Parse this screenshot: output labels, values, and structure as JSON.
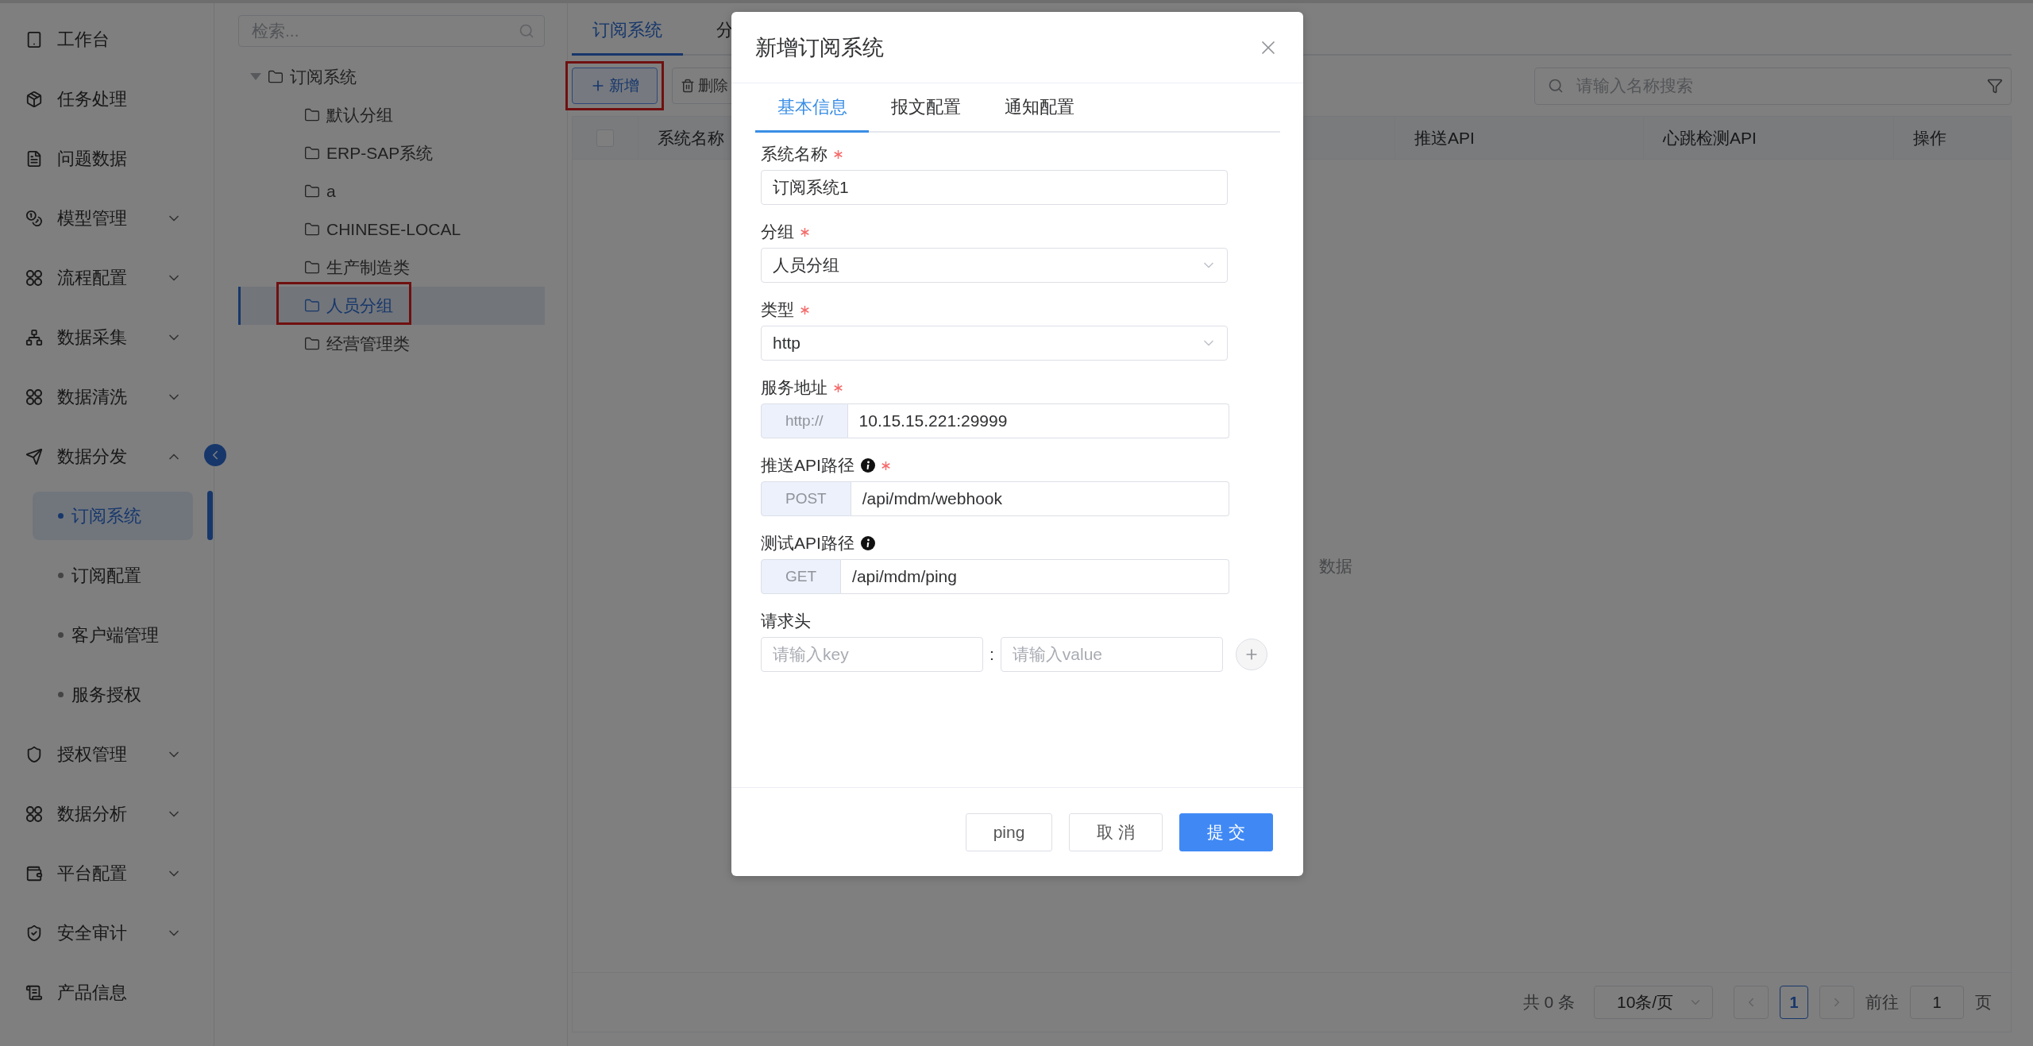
{
  "sidebar": {
    "items": [
      {
        "kind": "link",
        "label": "工作台"
      },
      {
        "kind": "link",
        "label": "任务处理"
      },
      {
        "kind": "link",
        "label": "问题数据"
      },
      {
        "kind": "group",
        "label": "模型管理",
        "expanded": false
      },
      {
        "kind": "group",
        "label": "流程配置",
        "expanded": false
      },
      {
        "kind": "group",
        "label": "数据采集",
        "expanded": false
      },
      {
        "kind": "group",
        "label": "数据清洗",
        "expanded": false
      },
      {
        "kind": "group",
        "label": "数据分发",
        "expanded": true,
        "children": [
          {
            "label": "订阅系统",
            "selected": true
          },
          {
            "label": "订阅配置",
            "selected": false
          },
          {
            "label": "客户端管理",
            "selected": false
          },
          {
            "label": "服务授权",
            "selected": false
          }
        ]
      },
      {
        "kind": "group",
        "label": "授权管理",
        "expanded": false
      },
      {
        "kind": "group",
        "label": "数据分析",
        "expanded": false
      },
      {
        "kind": "group",
        "label": "平台配置",
        "expanded": false
      },
      {
        "kind": "group",
        "label": "安全审计",
        "expanded": false
      },
      {
        "kind": "link",
        "label": "产品信息"
      }
    ]
  },
  "tree": {
    "search": {
      "placeholder": "检索..."
    },
    "nodes": [
      {
        "label": "订阅系统",
        "expanded": true,
        "selected": false,
        "highlighted": false,
        "children": [
          {
            "label": "默认分组",
            "selected": false,
            "highlighted": false
          },
          {
            "label": "ERP-SAP系统",
            "selected": false,
            "highlighted": false
          },
          {
            "label": "a",
            "selected": false,
            "highlighted": false
          },
          {
            "label": "CHINESE-LOCAL",
            "selected": false,
            "highlighted": false
          },
          {
            "label": "生产制造类",
            "selected": false,
            "highlighted": false
          },
          {
            "label": "人员分组",
            "selected": true,
            "highlighted": true
          },
          {
            "label": "经营管理类",
            "selected": false,
            "highlighted": false
          }
        ]
      }
    ]
  },
  "main": {
    "tabs": [
      {
        "label": "订阅系统",
        "selected": true
      },
      {
        "label": "分",
        "selected": false
      }
    ],
    "toolbar": {
      "buttons": [
        {
          "kind": "add",
          "label": "新增",
          "highlighted": true
        },
        {
          "kind": "delete",
          "label": "删除",
          "highlighted": false
        }
      ],
      "search": {
        "placeholder": "请输入名称搜索"
      }
    },
    "table": {
      "select_all": {
        "checked": false
      },
      "columns": [
        "系统名称",
        "推送API",
        "心跳检测API",
        "操作"
      ],
      "empty_text": "数据"
    },
    "pagination": {
      "total": "共 0 条",
      "page_size": "10条/页",
      "pages": [
        {
          "label": "1",
          "selected": true
        }
      ],
      "goto_label": "前往",
      "goto_value": "1",
      "goto_suffix": "页"
    }
  },
  "dialog": {
    "title": "新增订阅系统",
    "tabs": [
      {
        "label": "基本信息",
        "selected": true
      },
      {
        "label": "报文配置",
        "selected": false
      },
      {
        "label": "通知配置",
        "selected": false
      }
    ],
    "fields": [
      {
        "kind": "text",
        "label": "系统名称",
        "required": true,
        "info": false,
        "value": "订阅系统1"
      },
      {
        "kind": "select",
        "label": "分组",
        "required": true,
        "info": false,
        "value": "人员分组"
      },
      {
        "kind": "select",
        "label": "类型",
        "required": true,
        "info": false,
        "value": "http"
      },
      {
        "kind": "prefixed",
        "label": "服务地址",
        "required": true,
        "info": false,
        "prefix": "http://",
        "value": "10.15.15.221:29999"
      },
      {
        "kind": "prefixed",
        "label": "推送API路径",
        "required": true,
        "info": true,
        "prefix": "POST",
        "value": "/api/mdm/webhook"
      },
      {
        "kind": "prefixed",
        "label": "测试API路径",
        "required": false,
        "info": true,
        "prefix": "GET",
        "value": "/api/mdm/ping"
      },
      {
        "kind": "pair",
        "label": "请求头",
        "required": false,
        "info": false,
        "key_placeholder": "请输入key",
        "separator": ":",
        "value_placeholder": "请输入value"
      }
    ],
    "buttons": [
      {
        "kind": "default",
        "label": "ping"
      },
      {
        "kind": "default",
        "label": "取 消"
      },
      {
        "kind": "primary",
        "label": "提 交"
      }
    ]
  }
}
